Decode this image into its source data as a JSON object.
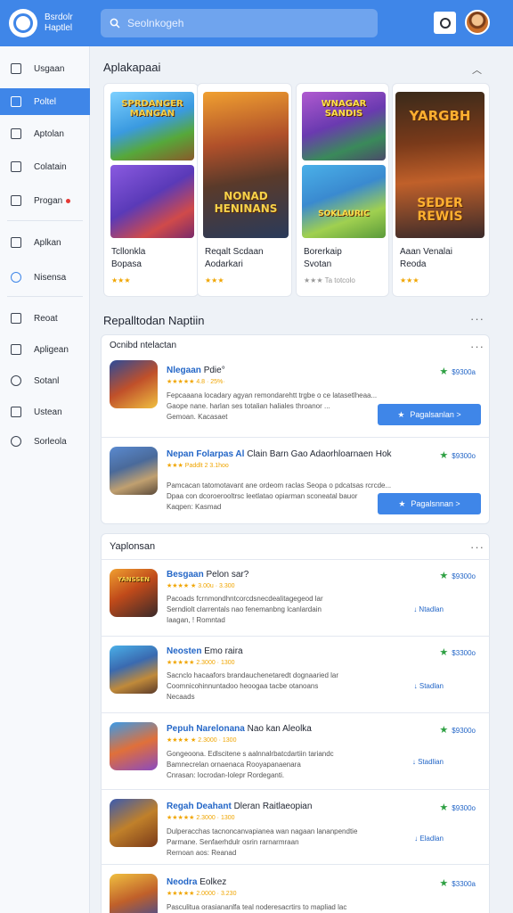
{
  "header": {
    "brand_line1": "Bsrdolr",
    "brand_line2": "Haptlel",
    "search_placeholder": "Seolnkogeh"
  },
  "sidebar": {
    "items": [
      {
        "label": "Usgaan"
      },
      {
        "label": "Poltel",
        "active": true
      },
      {
        "label": "Aptolan"
      },
      {
        "label": "Colatain"
      },
      {
        "label": "Progan",
        "badge": true
      },
      {
        "label": "Aplkan"
      },
      {
        "label": "Nisensa"
      },
      {
        "label": "Reoat"
      },
      {
        "label": "Apligean"
      },
      {
        "label": "Sotanl"
      },
      {
        "label": "Ustean"
      },
      {
        "label": "Sorleola"
      }
    ]
  },
  "featured": {
    "title": "Aplakapaai",
    "cards": [
      {
        "title_1": "Tcllonkla",
        "title_2": "Bopasa",
        "stars": "★★★",
        "art_1": "SPRDANGER MANGAN",
        "art_3": "NONAD HENINANS"
      },
      {
        "title_1": "Reqalt Scdaan",
        "title_2": "Aodarkari",
        "stars": "★★★"
      },
      {
        "title_1": "Borerkaip",
        "title_2": "Svotan",
        "stars": "★★★ Ta totcolo",
        "art_1": "WNAGAR SANDIS",
        "art_2": "SOKLAURIC"
      },
      {
        "title_1": "Aaan Venalai",
        "title_2": "Reoda",
        "stars": "★★★",
        "art_1": "YARGBH",
        "art_2": "SEDER REWIS"
      }
    ]
  },
  "recommended": {
    "title": "Repalltodan Naptiin",
    "subtitle": "Ocnibd ntelactan",
    "items": [
      {
        "name": "Nlegaan",
        "name_rest": "Pdie°",
        "rating": "★★★★★ 4.8 · 25%·",
        "desc_1": "Fepcaaana locadary agyan remondarehtt trgbe o ce latasetlheaa...",
        "desc_2": "Gaope nane. harlan ses totalian haliales throanor ...",
        "desc_3": "Gemoan. Kacasaet",
        "price": "$9300a",
        "cta": "Pagalsanlan >"
      },
      {
        "name": "Nepan Folarpas Al",
        "name_rest": "Clain Barn Gao Adaorhloarnaen Hok",
        "rating": "★★★ Paddlt 2 3.1hoo",
        "desc_1": "Pamcacan tatomotavant ane ordeom raclas Seopa o pdcatsas rcrcde...",
        "desc_2": "Dpaa con dcoroerooltrsc leetlatao opiarman sconeatal bauor",
        "desc_3": "Kaqpen: Kasmad",
        "price": "$9300o",
        "cta": "Pagalsnnan >"
      }
    ]
  },
  "popular": {
    "title": "Yaplonsan",
    "items": [
      {
        "name": "Besgaan",
        "name_rest": "Pelon sar?",
        "rating": "★★★★ ★ 3.00u · 3.300",
        "desc_1": "Pacoads fcrnmondhntcorcdsnecdealitagegeod lar",
        "desc_2": "Serndiolt clarrentals nao fenemanbng lcanlardain",
        "desc_3": "Iaagan, ! Romntad",
        "price": "$9300o",
        "action": "Ntadlan",
        "art": "YANSSEN"
      },
      {
        "name": "Neosten",
        "name_rest": "Emo raira",
        "rating": "★★★★★ 2.3000 · 1300",
        "desc_1": "Sacnclo hacaafors brandauchenetaredt dognaaried lar",
        "desc_2": "Coomnicohinnuntadoo heoogaa tacbe otanoans",
        "desc_3": "Necaads",
        "price": "$3300o",
        "action": "Stadlan"
      },
      {
        "name": "Pepuh Narelonana",
        "name_rest": "Nao kan Aleolka",
        "rating": "★★★★ ★ 2.3000 · 1300",
        "desc_1": "Gongeoona. Edlscitene s aalnnalrbatcdartiin tariandc",
        "desc_2": "Bamnecrelan ornaenaca Rooyapanaenara",
        "desc_3": "Cnrasan: Iocrodan-Iolepr Rordeganti.",
        "price": "$9300o",
        "action": "Stadlian"
      },
      {
        "name": "Regah Deahant",
        "name_rest": "Dleran Raitlaeopian",
        "rating": "★★★★★ 2.3000 · 1300",
        "desc_1": "Dulperacchas tacnoncanvapianea wan nagaan lananpendtie",
        "desc_2": "Parmane. Senfaerhdulr osrin rarnarmraan",
        "desc_3": "Rernoan aos: Reanad",
        "price": "$9300o",
        "action": "Eladlan"
      },
      {
        "name": "Neodra",
        "name_rest": "Eolkez",
        "rating": "★★★★★ 2.0000 · 3.230",
        "desc_1": "Pasculitua orasiananlfa teal noderesacrtirs to mapliad lac",
        "desc_2": "",
        "desc_3": "",
        "price": "$3300a",
        "action": ""
      }
    ]
  }
}
